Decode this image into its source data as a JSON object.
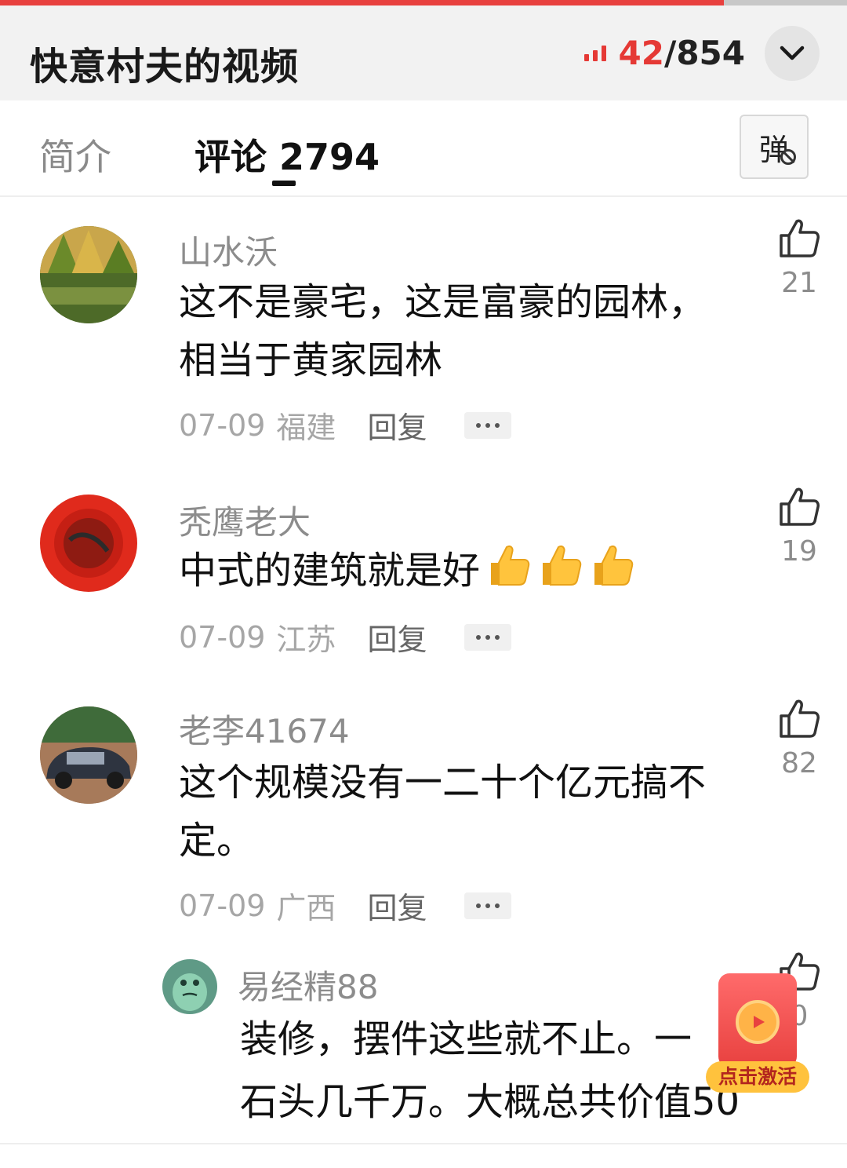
{
  "header": {
    "title": "快意村夫的视频",
    "counter_current": "42",
    "counter_separator": "/",
    "counter_total": "854",
    "progress_fraction": 0.855
  },
  "tabs": {
    "intro_label": "简介",
    "comments_label": "评论 2794",
    "danmaku_label": "弹"
  },
  "comments": [
    {
      "username": "山水沃",
      "lines": [
        "这不是豪宅，这是富豪的园林，",
        "相当于黄家园林"
      ],
      "date": "07-09",
      "location": "福建",
      "reply_label": "回复",
      "likes": "21"
    },
    {
      "username": "秃鹰老大",
      "lines": [
        "中式的建筑就是好"
      ],
      "emoji": [
        "thumbs-up",
        "thumbs-up",
        "thumbs-up"
      ],
      "date": "07-09",
      "location": "江苏",
      "reply_label": "回复",
      "likes": "19"
    },
    {
      "username": "老李41674",
      "lines": [
        "这个规模没有一二十个亿元搞不",
        "定。"
      ],
      "date": "07-09",
      "location": "广西",
      "reply_label": "回复",
      "likes": "82"
    }
  ],
  "reply": {
    "username": "易经精88",
    "lines": [
      "装修，摆件这些就不止。一",
      "石头几千万。大概总共价值50"
    ],
    "likes": "0"
  },
  "promo": {
    "label": "点击激活"
  },
  "colors": {
    "accent": "#e53935",
    "header_bg": "#f2f2f2",
    "muted_text": "#8c8c8c"
  }
}
